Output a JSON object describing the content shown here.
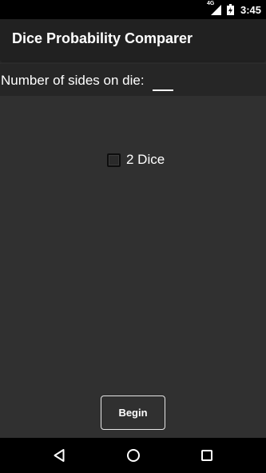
{
  "status_bar": {
    "network_label": "4G",
    "time": "3:45",
    "icons": [
      "signal-icon",
      "battery-icon"
    ]
  },
  "action_bar": {
    "title": "Dice Probability Comparer"
  },
  "form": {
    "sides_label": "Number of sides on die:",
    "sides_value": "",
    "two_dice_label": "2 Dice",
    "two_dice_checked": false
  },
  "begin_button": {
    "label": "Begin"
  },
  "nav_bar": {
    "icons": [
      "back-icon",
      "home-icon",
      "recents-icon"
    ]
  },
  "colors": {
    "background": "#303030",
    "action_bar": "#212121",
    "status_bar": "#000000",
    "text": "#ffffff"
  }
}
